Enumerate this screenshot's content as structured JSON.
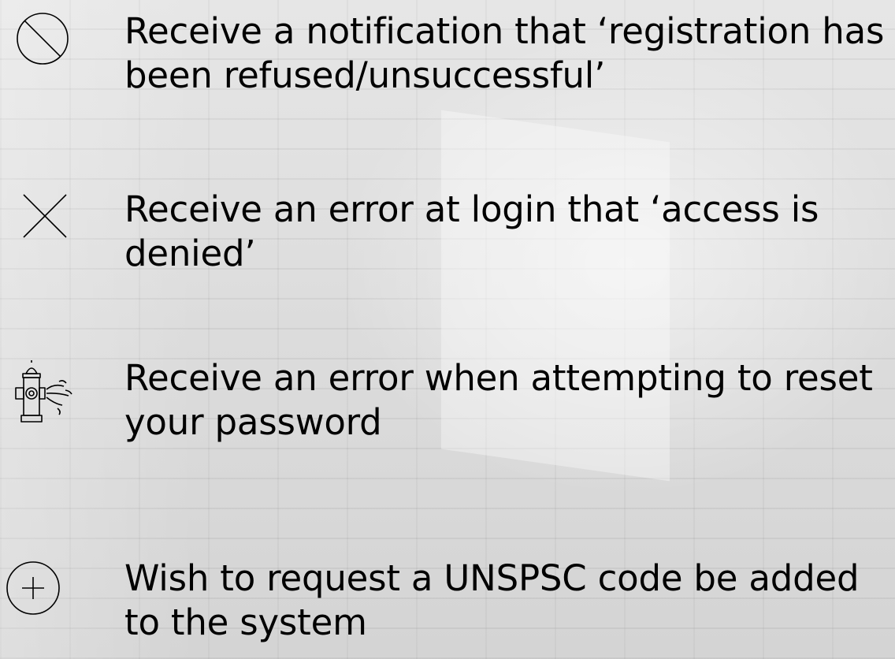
{
  "items": [
    {
      "icon": "prohibited-icon",
      "text": "Receive a notification that ‘registration has been refused/unsuccessful’"
    },
    {
      "icon": "close-x-icon",
      "text": "Receive an error at login that ‘access is denied’"
    },
    {
      "icon": "fire-hydrant-icon",
      "text": "Receive an error when attempting to reset your password"
    },
    {
      "icon": "plus-circle-icon",
      "text": "Wish to request a UNSPSC code be added to the system"
    }
  ],
  "colors": {
    "text": "#000000",
    "background": "#d9d9d9"
  }
}
